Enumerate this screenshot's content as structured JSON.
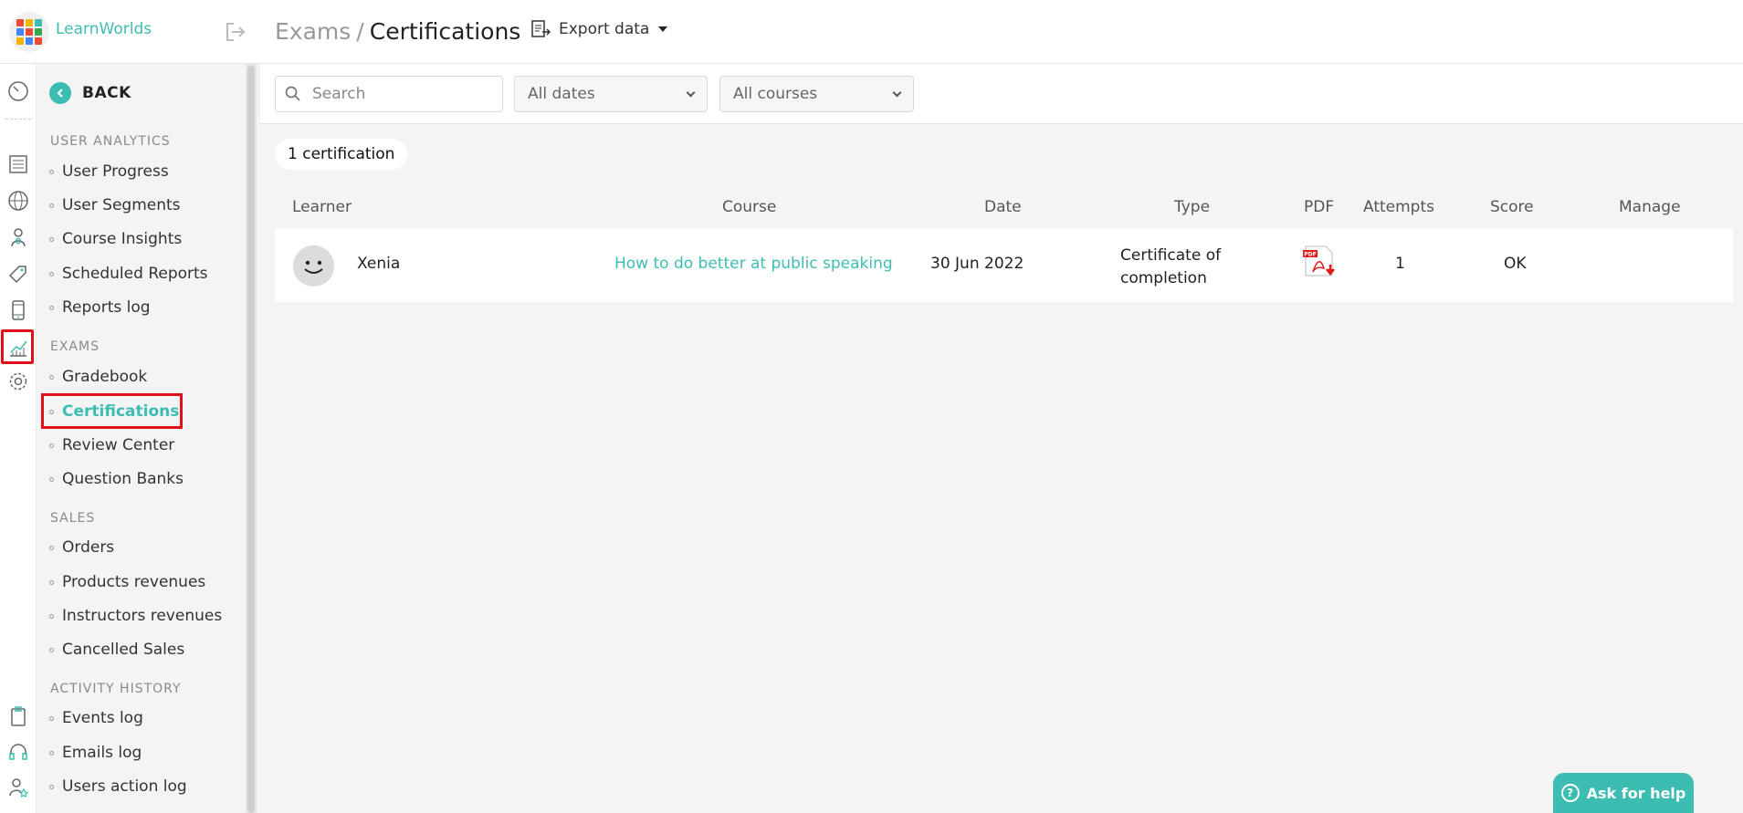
{
  "app": {
    "name": "LearnWorlds"
  },
  "header": {
    "breadcrumb_parent": "Exams",
    "breadcrumb_separator": "/",
    "title": "Certifications",
    "export_label": "Export data"
  },
  "nav": {
    "back_label": "BACK",
    "sections": [
      {
        "title": "USER ANALYTICS",
        "items": [
          "User Progress",
          "User Segments",
          "Course Insights",
          "Scheduled Reports",
          "Reports log"
        ]
      },
      {
        "title": "EXAMS",
        "items": [
          "Gradebook",
          "Certifications",
          "Review Center",
          "Question Banks"
        ]
      },
      {
        "title": "SALES",
        "items": [
          "Orders",
          "Products revenues",
          "Instructors revenues",
          "Cancelled Sales"
        ]
      },
      {
        "title": "ACTIVITY HISTORY",
        "items": [
          "Events log",
          "Emails log",
          "Users action log"
        ]
      }
    ],
    "active_item": "Certifications"
  },
  "rail_icons": [
    "dashboard-gauge-icon",
    "pages-icon",
    "globe-icon",
    "users-icon",
    "tag-icon",
    "mobile-icon",
    "analytics-chart-icon",
    "settings-gear-icon",
    "clipboard-icon",
    "headset-icon",
    "user-star-icon"
  ],
  "filters": {
    "search_placeholder": "Search",
    "dates_value": "All dates",
    "courses_value": "All courses"
  },
  "results": {
    "count_label": "1 certification",
    "columns": [
      "Learner",
      "Course",
      "Date",
      "Type",
      "PDF",
      "Attempts",
      "Score",
      "Manage"
    ],
    "rows": [
      {
        "learner": "Xenia",
        "course": "How to do better at public speaking",
        "date": "30 Jun 2022",
        "type_line1": "Certificate of",
        "type_line2": "completion",
        "attempts": "1",
        "score": "OK"
      }
    ]
  },
  "help": {
    "label": "Ask for help"
  },
  "colors": {
    "accent": "#3dbdb2",
    "highlight": "#e0101a"
  }
}
